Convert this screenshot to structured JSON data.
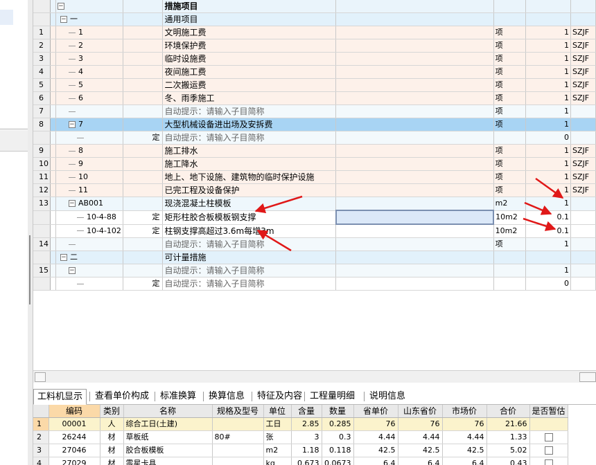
{
  "main_grid": {
    "header_partial": "措施项目",
    "rows": [
      {
        "rn": "",
        "code": "一",
        "tree": "box",
        "indent": 1,
        "type": "",
        "name": "通用项目",
        "unit": "",
        "qty": "",
        "extra": "",
        "style": "sec"
      },
      {
        "rn": "1",
        "code": "1",
        "tree": "line",
        "indent": 2,
        "type": "",
        "name": "文明施工费",
        "unit": "项",
        "qty": "1",
        "extra": "SZJF",
        "style": "item"
      },
      {
        "rn": "2",
        "code": "2",
        "tree": "line",
        "indent": 2,
        "type": "",
        "name": "环境保护费",
        "unit": "项",
        "qty": "1",
        "extra": "SZJF",
        "style": "item"
      },
      {
        "rn": "3",
        "code": "3",
        "tree": "line",
        "indent": 2,
        "type": "",
        "name": "临时设施费",
        "unit": "项",
        "qty": "1",
        "extra": "SZJF",
        "style": "item"
      },
      {
        "rn": "4",
        "code": "4",
        "tree": "line",
        "indent": 2,
        "type": "",
        "name": "夜间施工费",
        "unit": "项",
        "qty": "1",
        "extra": "SZJF",
        "style": "item"
      },
      {
        "rn": "5",
        "code": "5",
        "tree": "line",
        "indent": 2,
        "type": "",
        "name": "二次搬运费",
        "unit": "项",
        "qty": "1",
        "extra": "SZJF",
        "style": "item"
      },
      {
        "rn": "6",
        "code": "6",
        "tree": "line",
        "indent": 2,
        "type": "",
        "name": "冬、雨季施工",
        "unit": "项",
        "qty": "1",
        "extra": "SZJF",
        "style": "item"
      },
      {
        "rn": "7",
        "code": "",
        "tree": "line",
        "indent": 2,
        "type": "",
        "name": "自动提示：请输入子目简称",
        "unit": "项",
        "qty": "1",
        "extra": "",
        "style": "auto"
      },
      {
        "rn": "8",
        "code": "7",
        "tree": "box",
        "indent": 2,
        "type": "",
        "name": "大型机械设备进出场及安拆费",
        "unit": "项",
        "qty": "1",
        "extra": "",
        "style": "sel"
      },
      {
        "rn": "",
        "code": "",
        "tree": "line",
        "indent": 3,
        "type": "定",
        "name": "自动提示：请输入子目简称",
        "unit": "",
        "qty": "0",
        "extra": "",
        "style": "auto"
      },
      {
        "rn": "9",
        "code": "8",
        "tree": "line",
        "indent": 2,
        "type": "",
        "name": "施工排水",
        "unit": "项",
        "qty": "1",
        "extra": "SZJF",
        "style": "item"
      },
      {
        "rn": "10",
        "code": "9",
        "tree": "line",
        "indent": 2,
        "type": "",
        "name": "施工降水",
        "unit": "项",
        "qty": "1",
        "extra": "SZJF",
        "style": "item"
      },
      {
        "rn": "11",
        "code": "10",
        "tree": "line",
        "indent": 2,
        "type": "",
        "name": "地上、地下设施、建筑物的临时保护设施",
        "unit": "项",
        "qty": "1",
        "extra": "SZJF",
        "style": "item"
      },
      {
        "rn": "12",
        "code": "11",
        "tree": "line",
        "indent": 2,
        "type": "",
        "name": "已完工程及设备保护",
        "unit": "项",
        "qty": "1",
        "extra": "SZJF",
        "style": "item"
      },
      {
        "rn": "13",
        "code": "AB001",
        "tree": "box",
        "indent": 2,
        "type": "",
        "name": "现浇混凝土柱模板",
        "unit": "m2",
        "qty": "1",
        "extra": "",
        "style": "ab"
      },
      {
        "rn": "",
        "code": "10-4-88",
        "tree": "line",
        "indent": 3,
        "type": "定",
        "name": "矩形柱胶合板模板钢支撑",
        "unit": "10m2",
        "qty": "0.1",
        "extra": "",
        "style": "plain",
        "current": true,
        "edit": true
      },
      {
        "rn": "",
        "code": "10-4-102",
        "tree": "line",
        "indent": 3,
        "type": "定",
        "name": "柱钢支撑高超过3.6m每增3m",
        "unit": "10m2",
        "qty": "0.1",
        "extra": "",
        "style": "plain"
      },
      {
        "rn": "14",
        "code": "",
        "tree": "line",
        "indent": 2,
        "type": "",
        "name": "自动提示：请输入子目简称",
        "unit": "项",
        "qty": "1",
        "extra": "",
        "style": "auto"
      },
      {
        "rn": "",
        "code": "二",
        "tree": "box",
        "indent": 1,
        "type": "",
        "name": "可计量措施",
        "unit": "",
        "qty": "",
        "extra": "",
        "style": "sec"
      },
      {
        "rn": "15",
        "code": "",
        "tree": "box",
        "indent": 2,
        "type": "",
        "name": "自动提示：请输入子目简称",
        "unit": "",
        "qty": "1",
        "extra": "",
        "style": "auto"
      },
      {
        "rn": "",
        "code": "",
        "tree": "line",
        "indent": 3,
        "type": "定",
        "name": "自动提示：请输入子目简称",
        "unit": "",
        "qty": "0",
        "extra": "",
        "style": "plain"
      }
    ]
  },
  "tabs": [
    {
      "label": "工料机显示",
      "active": true
    },
    {
      "label": "查看单价构成"
    },
    {
      "label": "标准换算"
    },
    {
      "label": "换算信息"
    },
    {
      "label": "特征及内容"
    },
    {
      "label": "工程量明细"
    },
    {
      "label": "说明信息"
    }
  ],
  "bottom_grid": {
    "headers": [
      "编码",
      "类别",
      "名称",
      "规格及型号",
      "单位",
      "含量",
      "数量",
      "省单价",
      "山东省价",
      "市场价",
      "合价",
      "是否暂估"
    ],
    "rows": [
      {
        "rn": "1",
        "code": "00001",
        "cat": "人",
        "name": "综合工日(土建)",
        "spec": "",
        "unit": "工日",
        "content": "2.85",
        "qty": "0.285",
        "prov": "76",
        "sd": "76",
        "market": "76",
        "total": "21.66",
        "check": false
      },
      {
        "rn": "2",
        "code": "26244",
        "cat": "材",
        "name": "草板纸",
        "spec": "80#",
        "unit": "张",
        "content": "3",
        "qty": "0.3",
        "prov": "4.44",
        "sd": "4.44",
        "market": "4.44",
        "total": "1.33",
        "check": true
      },
      {
        "rn": "3",
        "code": "27046",
        "cat": "材",
        "name": "胶合板模板",
        "spec": "",
        "unit": "m2",
        "content": "1.18",
        "qty": "0.118",
        "prov": "42.5",
        "sd": "42.5",
        "market": "42.5",
        "total": "5.02",
        "check": true
      },
      {
        "rn": "4",
        "code": "27029",
        "cat": "材",
        "name": "零星卡具",
        "spec": "",
        "unit": "kg",
        "content": "0.673",
        "qty": "0.0673",
        "prov": "6.4",
        "sd": "6.4",
        "market": "6.4",
        "total": "0.43",
        "check": true
      }
    ]
  },
  "colors": {
    "selected_row": "#a8d4f4",
    "item_row": "#fdf1ea",
    "section_row": "#e2f1fb",
    "current_marker": "#fbd9a8",
    "arrow": "#e01818"
  }
}
